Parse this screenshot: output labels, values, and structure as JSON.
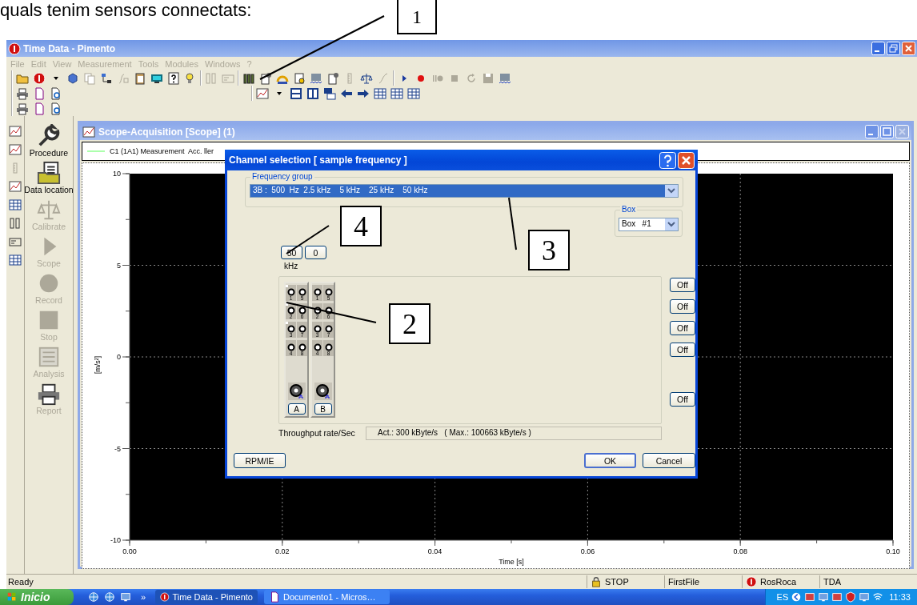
{
  "document_text": "quals tenim sensors connectats:",
  "window": {
    "title": "Time Data - Pimento"
  },
  "menu": [
    {
      "label": "File",
      "disabled": true
    },
    {
      "label": "Edit",
      "disabled": true
    },
    {
      "label": "View",
      "disabled": true
    },
    {
      "label": "Measurement",
      "disabled": true
    },
    {
      "label": "Tools",
      "disabled": true
    },
    {
      "label": "Modules",
      "disabled": true
    },
    {
      "label": "Windows",
      "disabled": true
    },
    {
      "label": "?",
      "disabled": true
    }
  ],
  "sidebar": {
    "items": [
      {
        "label": "Procedure",
        "disabled": false
      },
      {
        "label": "Data location",
        "disabled": false
      },
      {
        "label": "Calibrate",
        "disabled": true
      },
      {
        "label": "Scope",
        "disabled": true
      },
      {
        "label": "Record",
        "disabled": true
      },
      {
        "label": "Stop",
        "disabled": true
      },
      {
        "label": "Analysis",
        "disabled": true
      },
      {
        "label": "Report",
        "disabled": true
      }
    ]
  },
  "scope_window": {
    "title": "Scope-Acquisition [Scope] (1)",
    "chart_data": {
      "type": "line",
      "xlabel": "Time [s]",
      "ylabel": "[m/s²]",
      "ylim": [
        -10,
        10
      ],
      "grid": true,
      "categories": [
        "0.00",
        "0.02",
        "0.04",
        "0.06",
        "0.08",
        "0.10"
      ],
      "yticks": [
        {
          "value": -10,
          "label": "-10"
        },
        {
          "value": -5,
          "label": "-5"
        },
        {
          "value": 0,
          "label": "0"
        },
        {
          "value": 5,
          "label": "5"
        },
        {
          "value": 10,
          "label": "10"
        }
      ],
      "series": [
        {
          "name": "C1 (1A1) Measurement  Acc. ller",
          "color": "#00ff00",
          "values": [
            null,
            null,
            null,
            null,
            null,
            null
          ]
        }
      ]
    }
  },
  "dialog": {
    "title": "Channel selection [ sample frequency ]",
    "frequency_group": {
      "label": "Frequency group",
      "value": "3B :  500  Hz  2.5 kHz    5 kHz    25 kHz    50 kHz",
      "selected": true
    },
    "box": {
      "label": "Box",
      "value": "Box   #1"
    },
    "rate_buttons": [
      "50",
      "0"
    ],
    "unit": "kHz",
    "modules": [
      {
        "label": "A",
        "channels": [
          {
            "number": "1",
            "checked": true
          },
          {
            "number": "2",
            "checked": true
          },
          {
            "number": "3",
            "checked": true
          },
          {
            "number": "4",
            "checked": false
          },
          {
            "number": "5",
            "checked": false
          },
          {
            "number": "6",
            "checked": false
          },
          {
            "number": "7",
            "checked": false
          },
          {
            "number": "8",
            "checked": false
          }
        ]
      },
      {
        "label": "B",
        "channels": [
          {
            "number": "1",
            "checked": false
          },
          {
            "number": "2",
            "checked": false
          },
          {
            "number": "3",
            "checked": false
          },
          {
            "number": "4",
            "checked": false
          },
          {
            "number": "5",
            "checked": false
          },
          {
            "number": "6",
            "checked": false
          },
          {
            "number": "7",
            "checked": false
          },
          {
            "number": "8",
            "checked": false
          }
        ]
      }
    ],
    "off_buttons": [
      "Off",
      "Off",
      "Off",
      "Off",
      "Off"
    ],
    "throughput": {
      "label": "Throughput rate/Sec",
      "value": "Act.: 300 kByte/s   ( Max.: 100663 kByte/s )"
    },
    "buttons": [
      {
        "label": "RPM/IE",
        "default": false
      },
      {
        "label": "OK",
        "default": true
      },
      {
        "label": "Cancel",
        "default": false
      }
    ]
  },
  "callouts": [
    {
      "label": "1"
    },
    {
      "label": "4"
    },
    {
      "label": "3"
    },
    {
      "label": "2"
    }
  ],
  "status_bar": {
    "message": "Ready",
    "panes": [
      "STOP",
      "FirstFile",
      "RosRoca",
      "TDA"
    ]
  },
  "taskbar": {
    "start": "Inicio",
    "more": "»",
    "tasks": [
      {
        "label": "Time Data - Pimento",
        "selected": true
      },
      {
        "label": "Documento1 - Micros…",
        "selected": false
      }
    ],
    "language": "ES",
    "clock": "11:33"
  }
}
